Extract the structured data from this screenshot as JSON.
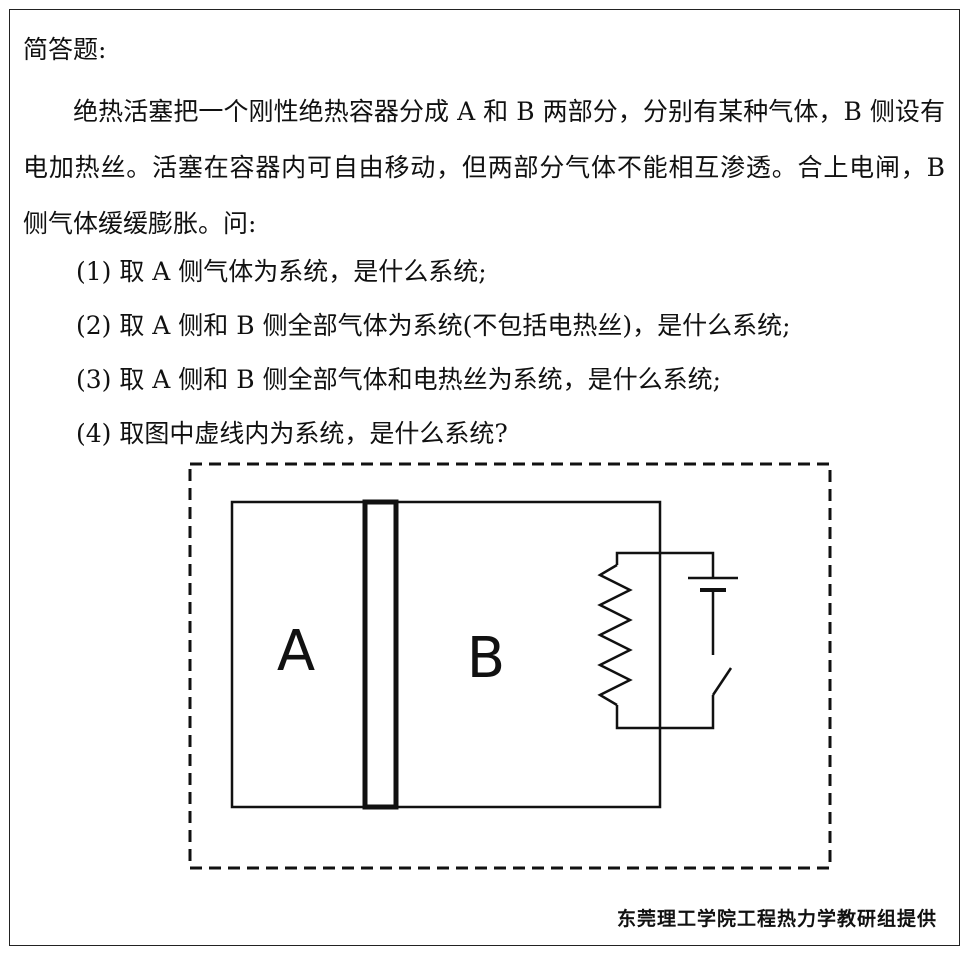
{
  "heading": "简答题:",
  "paragraph": "绝热活塞把一个刚性绝热容器分成 A 和 B 两部分，分别有某种气体，B 侧设有电加热丝。活塞在容器内可自由移动，但两部分气体不能相互渗透。合上电闸，B 侧气体缓缓膨胀。问:",
  "questions": [
    "(1) 取 A 侧气体为系统，是什么系统;",
    "(2) 取 A 侧和 B 侧全部气体为系统(不包括电热丝)，是什么系统;",
    "(3) 取 A 侧和 B 侧全部气体和电热丝为系统，是什么系统;",
    "(4) 取图中虚线内为系统，是什么系统?"
  ],
  "diagram": {
    "label_a": "A",
    "label_b": "B",
    "line_color": "#111111"
  },
  "footer": "东莞理工学院工程热力学教研组提供"
}
